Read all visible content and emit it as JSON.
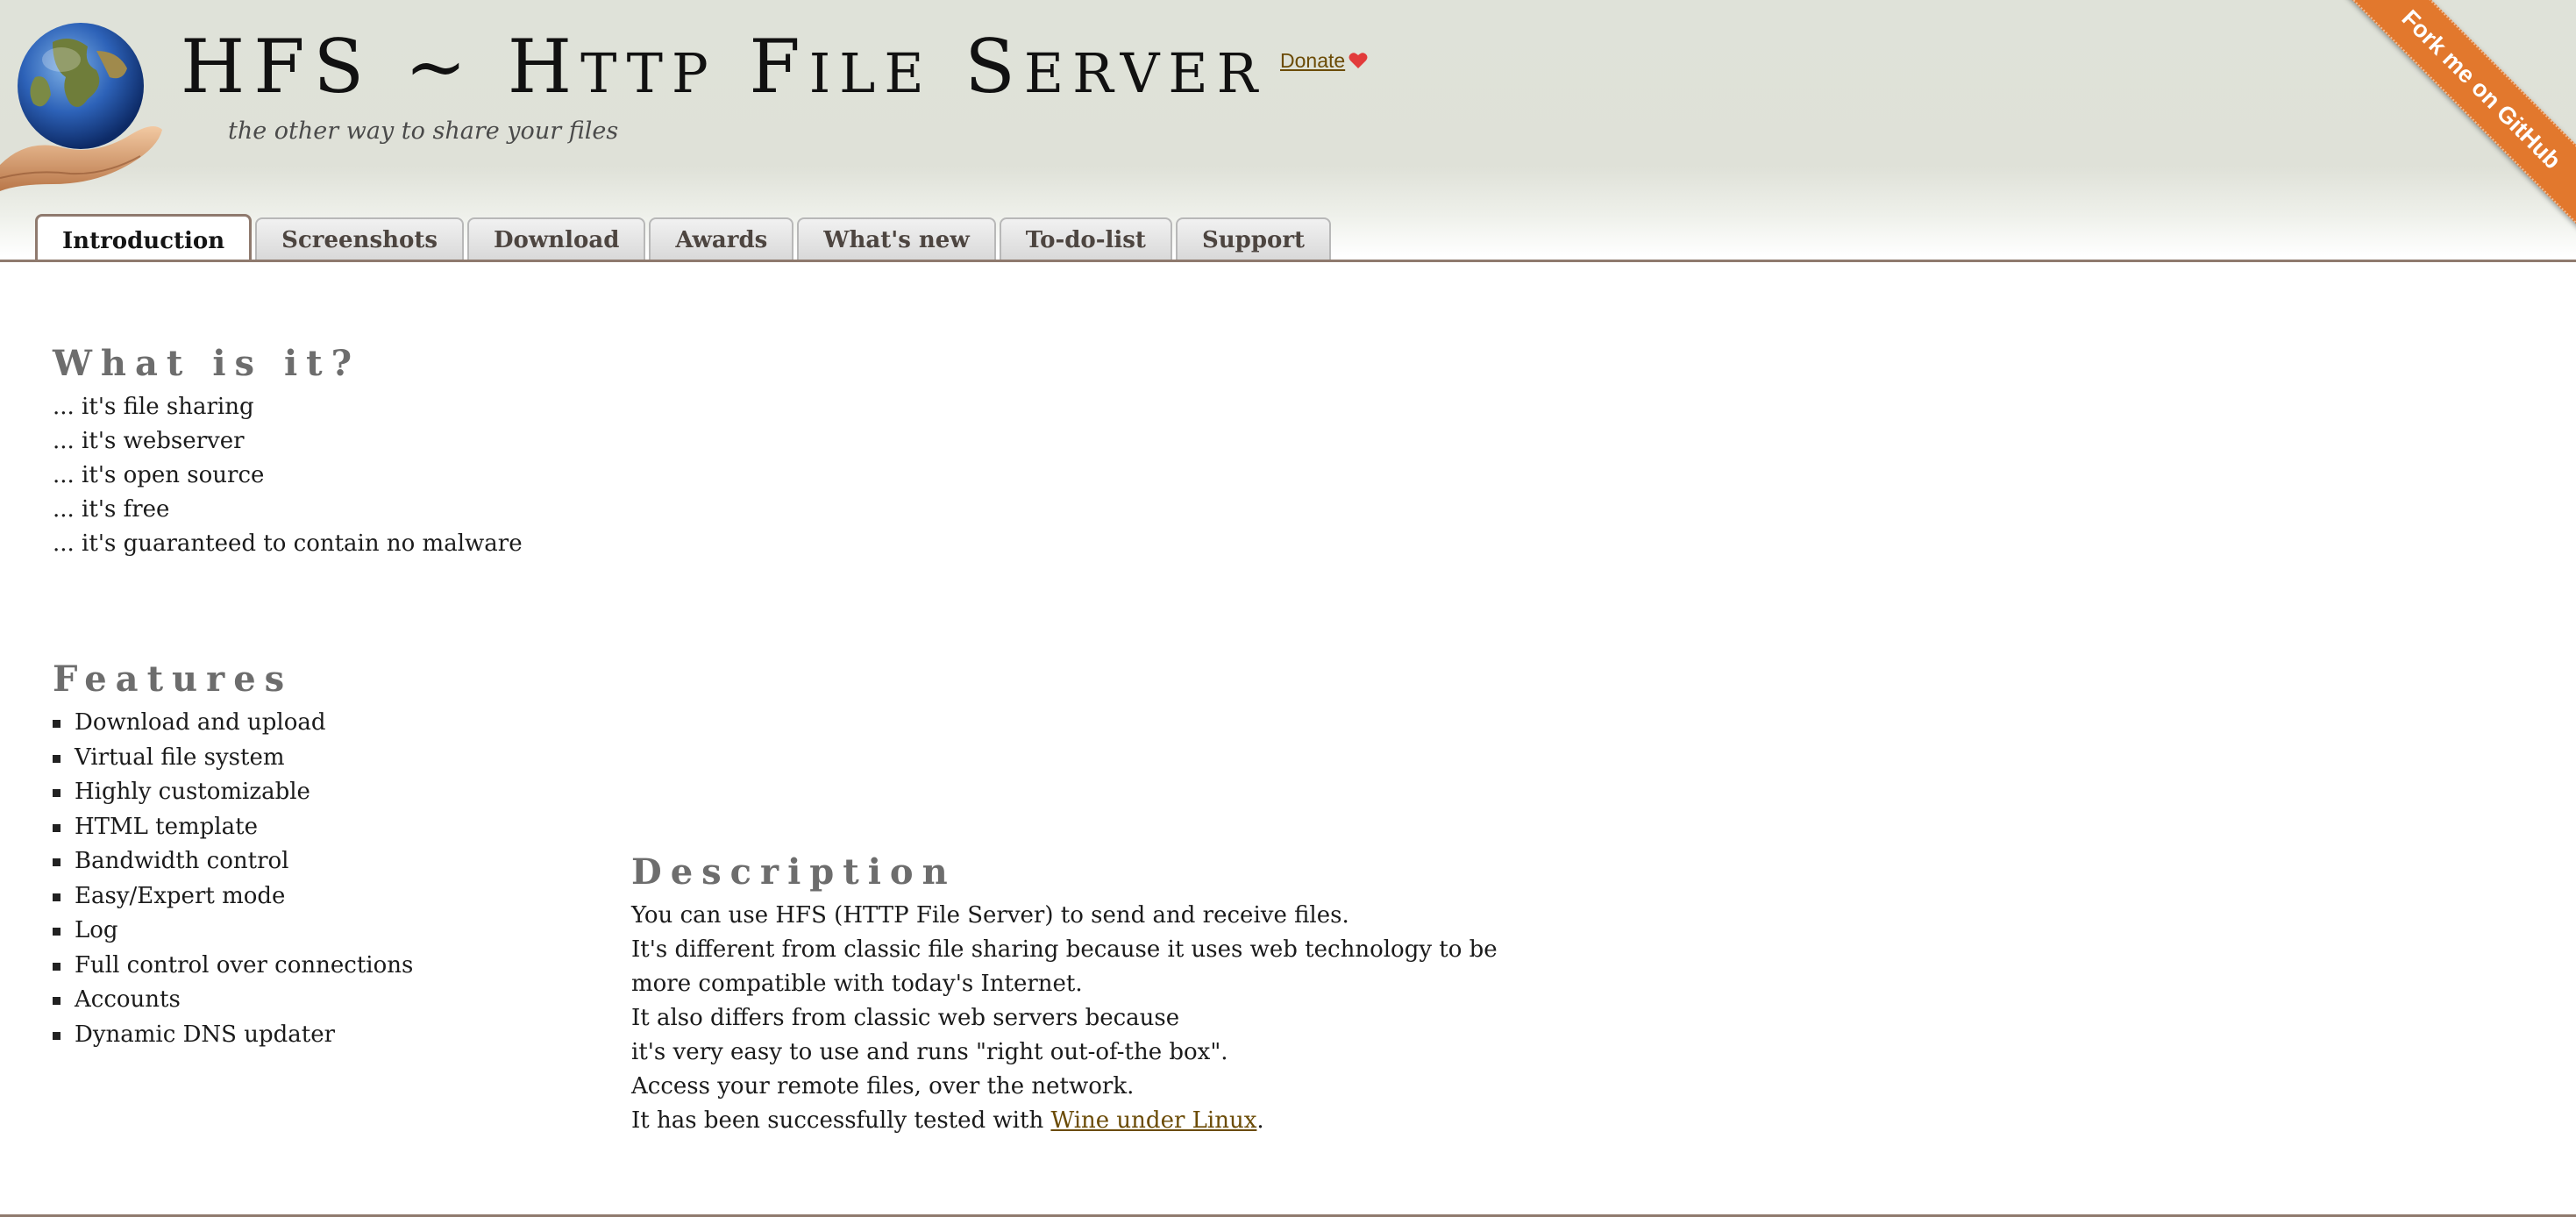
{
  "header": {
    "title_parts": [
      "HFS ~ H",
      "TTP",
      " F",
      "ILE",
      " S",
      "ERVER"
    ],
    "tagline": "the other way to share your files",
    "donate_label": "Donate",
    "fork_label": "Fork me on GitHub"
  },
  "tabs": [
    {
      "label": "Introduction",
      "active": true
    },
    {
      "label": "Screenshots"
    },
    {
      "label": "Download"
    },
    {
      "label": "Awards"
    },
    {
      "label": "What's new"
    },
    {
      "label": "To-do-list"
    },
    {
      "label": "Support"
    }
  ],
  "what_is_it": {
    "title": "What is it?",
    "lines": [
      "... it's file sharing",
      "... it's webserver",
      "... it's open source",
      "... it's free",
      "... it's guaranteed to contain no malware"
    ]
  },
  "features": {
    "title": "Features",
    "items": [
      "Download and upload",
      "Virtual file system",
      "Highly customizable",
      "HTML template",
      "Bandwidth control",
      "Easy/Expert mode",
      "Log",
      "Full control over connections",
      "Accounts",
      "Dynamic DNS updater"
    ]
  },
  "description": {
    "title": "Description",
    "lines": [
      "You can use HFS (HTTP File Server) to send and receive files.",
      "It's different from classic file sharing because it uses web technology to be",
      "more compatible with today's Internet.",
      "It also differs from classic web servers because",
      "it's very easy to use and runs \"right out-of-the box\".",
      "Access your remote files, over the network."
    ],
    "last_line_prefix": "It has been successfully tested with ",
    "wine_link": "Wine under Linux",
    "last_line_suffix": "."
  },
  "colors": {
    "header_bg": "#dfe2d9",
    "tab_border": "#8f7a6e",
    "link": "#6b4b05",
    "ribbon": "#e2782d",
    "section_title": "#6d6d6d"
  }
}
